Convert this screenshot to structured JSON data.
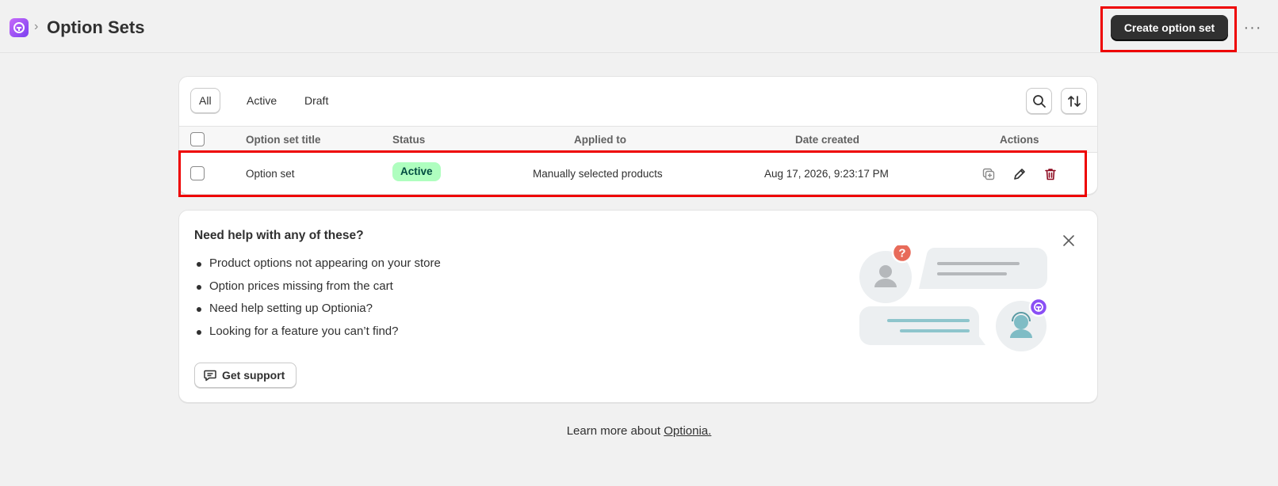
{
  "header": {
    "title": "Option Sets",
    "create_label": "Create option set",
    "more_label": "···",
    "chevron": "›"
  },
  "tabs": [
    {
      "label": "All",
      "selected": true
    },
    {
      "label": "Active",
      "selected": false
    },
    {
      "label": "Draft",
      "selected": false
    }
  ],
  "table": {
    "columns": [
      "Option set title",
      "Status",
      "Applied to",
      "Date created",
      "Actions"
    ],
    "rows": [
      {
        "title": "Option set",
        "status": "Active",
        "applied_to": "Manually selected products",
        "date_created": "Aug 17, 2026, 9:23:17 PM"
      }
    ]
  },
  "help": {
    "title": "Need help with any of these?",
    "items": [
      "Product options not appearing on your store",
      "Option prices missing from the cart",
      "Need help setting up Optionia?",
      "Looking for a feature you can’t find?"
    ],
    "support_label": "Get support",
    "question_mark": "?"
  },
  "footer": {
    "prefix": "Learn more about ",
    "link": "Optionia."
  },
  "colors": {
    "accent": "#303030",
    "active_badge_bg": "#affebf",
    "active_badge_text": "#014b40",
    "delete": "#8e0b21",
    "highlight": "#ee0000",
    "brand": "#8a4ff5"
  },
  "icons": [
    "app-logo-icon",
    "chevron-right-icon",
    "search-icon",
    "sort-icon",
    "duplicate-icon",
    "edit-icon",
    "delete-icon",
    "close-icon",
    "chat-icon",
    "more-icon"
  ]
}
